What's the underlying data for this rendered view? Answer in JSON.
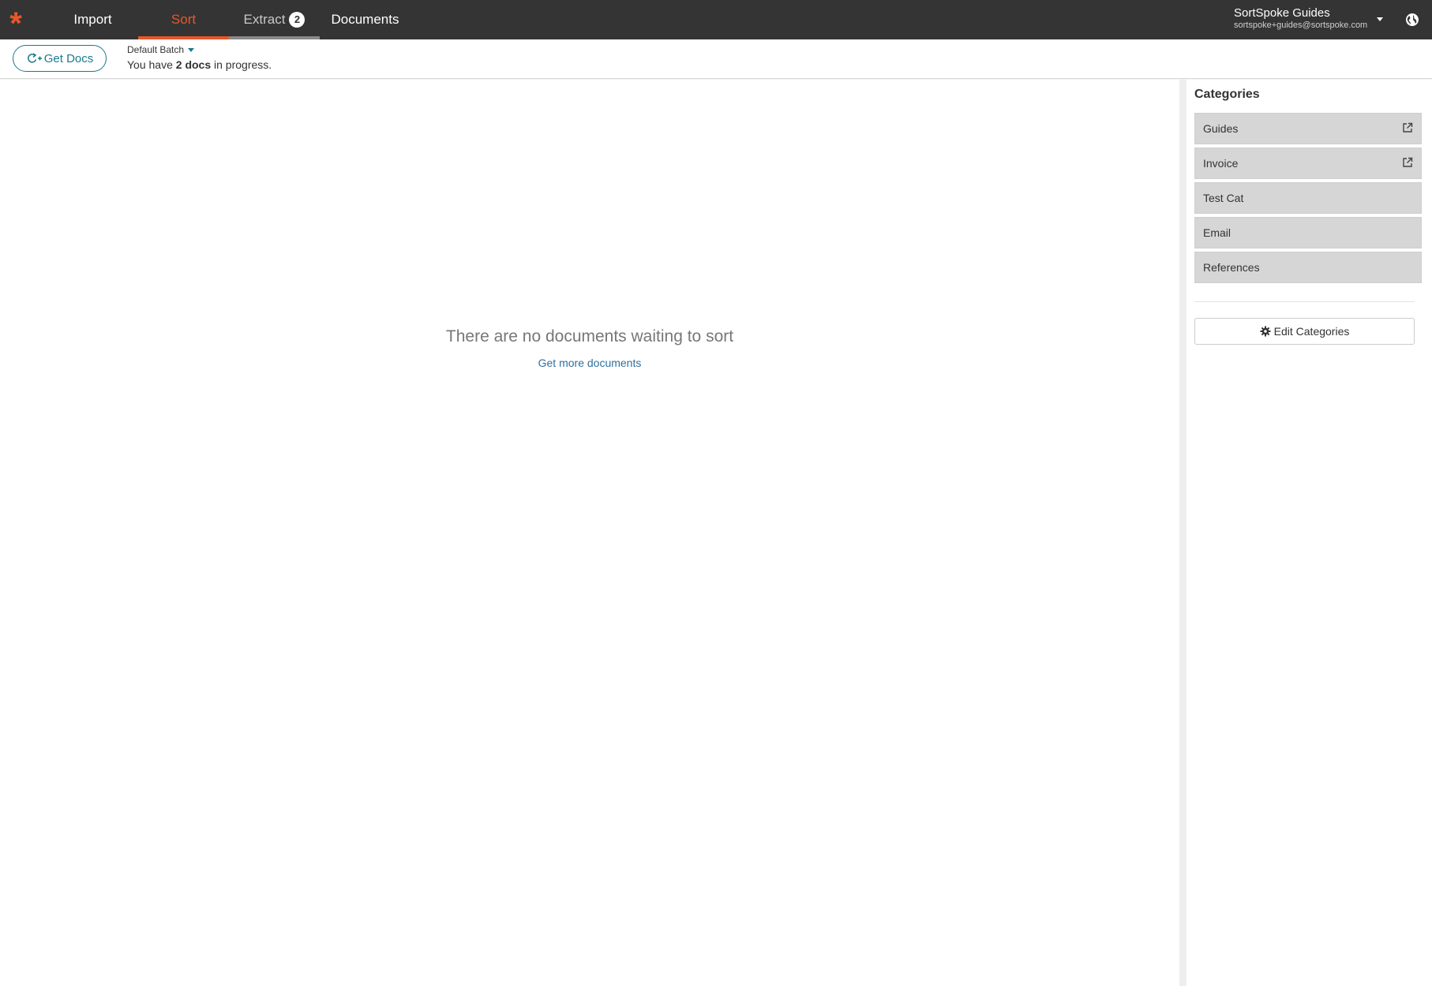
{
  "nav": {
    "logo": "*",
    "tabs": [
      {
        "label": "Import"
      },
      {
        "label": "Sort"
      },
      {
        "label": "Extract",
        "badge": "2"
      },
      {
        "label": "Documents"
      }
    ],
    "active_tab": "Sort",
    "accent_color": "#e8582a"
  },
  "user": {
    "name": "SortSpoke Guides",
    "email": "sortspoke+guides@sortspoke.com"
  },
  "toolbar": {
    "get_docs_label": "Get Docs",
    "batch_label": "Default Batch",
    "progress_prefix": "You have ",
    "progress_count": "2 docs",
    "progress_suffix": " in progress."
  },
  "main": {
    "empty_title": "There are no documents waiting to sort",
    "empty_link": "Get more documents"
  },
  "sidebar": {
    "title": "Categories",
    "categories": [
      {
        "label": "Guides",
        "external": true
      },
      {
        "label": "Invoice",
        "external": true
      },
      {
        "label": "Test Cat",
        "external": false
      },
      {
        "label": "Email",
        "external": false
      },
      {
        "label": "References",
        "external": false
      }
    ],
    "edit_label": "Edit Categories"
  },
  "icons": {
    "logo": "asterisk-logo",
    "refresh": "refresh-plus-icon",
    "globe": "globe-icon",
    "external": "external-link-icon",
    "gear": "gear-icon"
  }
}
